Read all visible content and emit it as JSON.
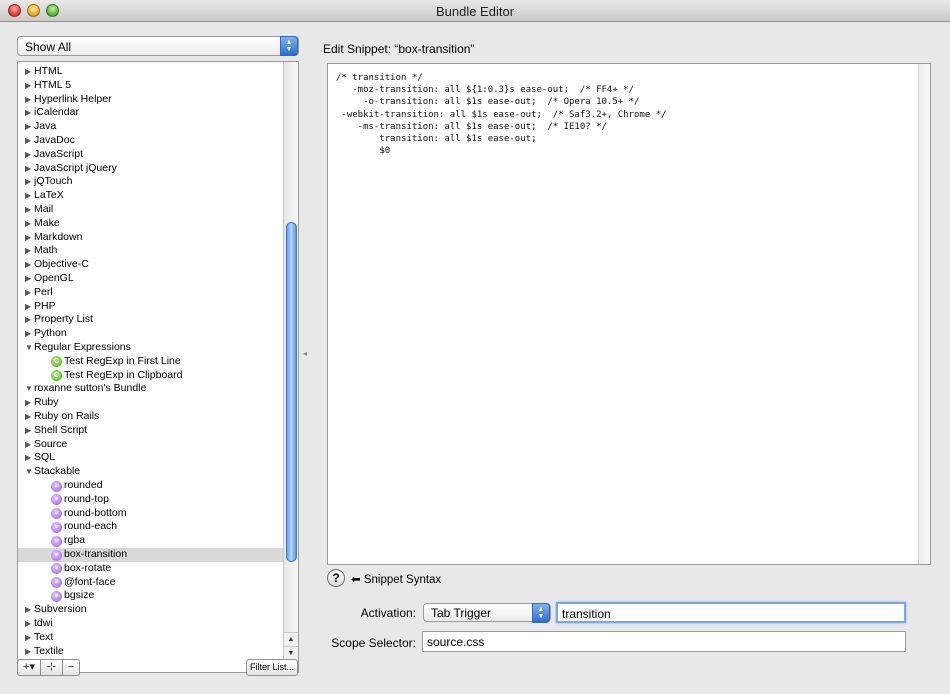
{
  "window": {
    "title": "Bundle Editor"
  },
  "sidebar": {
    "filter_select": "Show All",
    "filter_button": "Filter List...",
    "tools": {
      "add": "+▾",
      "add_group": "⊹",
      "remove": "−"
    },
    "items": [
      {
        "label": "HTML",
        "type": "bundle",
        "expanded": false
      },
      {
        "label": "HTML 5",
        "type": "bundle",
        "expanded": false
      },
      {
        "label": "Hyperlink Helper",
        "type": "bundle",
        "expanded": false
      },
      {
        "label": "iCalendar",
        "type": "bundle",
        "expanded": false
      },
      {
        "label": "Java",
        "type": "bundle",
        "expanded": false
      },
      {
        "label": "JavaDoc",
        "type": "bundle",
        "expanded": false
      },
      {
        "label": "JavaScript",
        "type": "bundle",
        "expanded": false
      },
      {
        "label": "JavaScript jQuery",
        "type": "bundle",
        "expanded": false
      },
      {
        "label": "jQTouch",
        "type": "bundle",
        "expanded": false
      },
      {
        "label": "LaTeX",
        "type": "bundle",
        "expanded": false
      },
      {
        "label": "Mail",
        "type": "bundle",
        "expanded": false
      },
      {
        "label": "Make",
        "type": "bundle",
        "expanded": false
      },
      {
        "label": "Markdown",
        "type": "bundle",
        "expanded": false
      },
      {
        "label": "Math",
        "type": "bundle",
        "expanded": false
      },
      {
        "label": "Objective-C",
        "type": "bundle",
        "expanded": false
      },
      {
        "label": "OpenGL",
        "type": "bundle",
        "expanded": false
      },
      {
        "label": "Perl",
        "type": "bundle",
        "expanded": false
      },
      {
        "label": "PHP",
        "type": "bundle",
        "expanded": false
      },
      {
        "label": "Property List",
        "type": "bundle",
        "expanded": false
      },
      {
        "label": "Python",
        "type": "bundle",
        "expanded": false
      },
      {
        "label": "Regular Expressions",
        "type": "bundle",
        "expanded": true
      },
      {
        "label": "Test RegExp in First Line",
        "type": "command"
      },
      {
        "label": "Test RegExp in Clipboard",
        "type": "command"
      },
      {
        "label": "roxanne sutton's Bundle",
        "type": "bundle",
        "expanded": true
      },
      {
        "label": "Ruby",
        "type": "bundle",
        "expanded": false
      },
      {
        "label": "Ruby on Rails",
        "type": "bundle",
        "expanded": false
      },
      {
        "label": "Shell Script",
        "type": "bundle",
        "expanded": false
      },
      {
        "label": "Source",
        "type": "bundle",
        "expanded": false
      },
      {
        "label": "SQL",
        "type": "bundle",
        "expanded": false
      },
      {
        "label": "Stackable",
        "type": "bundle",
        "expanded": true
      },
      {
        "label": "rounded",
        "type": "snippet"
      },
      {
        "label": "round-top",
        "type": "snippet"
      },
      {
        "label": "round-bottom",
        "type": "snippet"
      },
      {
        "label": "round-each",
        "type": "snippet"
      },
      {
        "label": "rgba",
        "type": "snippet"
      },
      {
        "label": "box-transition",
        "type": "snippet",
        "selected": true
      },
      {
        "label": "box-rotate",
        "type": "snippet"
      },
      {
        "label": "@font-face",
        "type": "snippet"
      },
      {
        "label": "bgsize",
        "type": "snippet"
      },
      {
        "label": "Subversion",
        "type": "bundle",
        "expanded": false
      },
      {
        "label": "tdwi",
        "type": "bundle",
        "expanded": false
      },
      {
        "label": "Text",
        "type": "bundle",
        "expanded": false
      },
      {
        "label": "Textile",
        "type": "bundle",
        "expanded": false
      }
    ]
  },
  "main": {
    "edit_title": "Edit Snippet: “box-transition”",
    "code_lines": [
      "/* transition */",
      "   -moz-transition: all ${1:0.3}s ease-out;  /* FF4+ */",
      "     -o-transition: all $1s ease-out;  /* Opera 10.5+ */",
      " -webkit-transition: all $1s ease-out;  /* Saf3.2+, Chrome */",
      "    -ms-transition: all $1s ease-out;  /* IE10? */",
      "        transition: all $1s ease-out;",
      "        $0"
    ],
    "help_icon": "?",
    "syntax_link": "⬅ Snippet Syntax",
    "activation_label": "Activation:",
    "activation_value": "Tab Trigger",
    "trigger_value": "transition",
    "scope_label": "Scope Selector:",
    "scope_value": "source.css"
  }
}
